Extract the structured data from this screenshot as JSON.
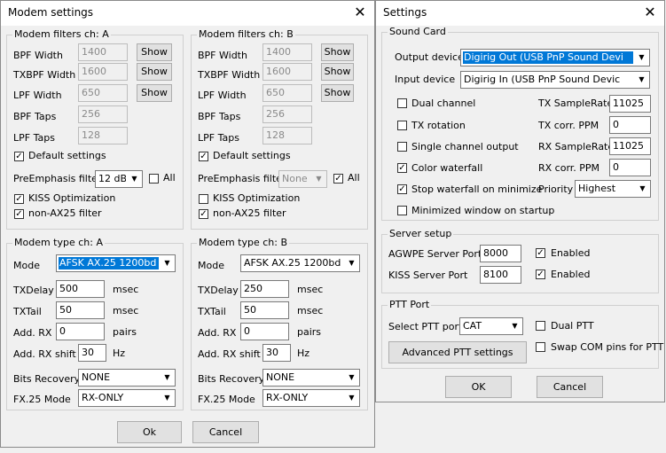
{
  "modem": {
    "title": "Modem settings",
    "filters": [
      {
        "legend": "Modem filters ch: A",
        "bpf_width_label": "BPF Width",
        "bpf_width": "1400",
        "txbpf_width_label": "TXBPF Width",
        "txbpf_width": "1600",
        "lpf_width_label": "LPF Width",
        "lpf_width": "650",
        "bpf_taps_label": "BPF Taps",
        "bpf_taps": "256",
        "lpf_taps_label": "LPF Taps",
        "lpf_taps": "128",
        "show_label": "Show",
        "default_label": "Default settings",
        "preemph_label": "PreEmphasis filter",
        "preemph_value": "12 dB",
        "all_label": "All",
        "kiss_label": "KISS Optimization",
        "nonax_label": "non-AX25 filter"
      },
      {
        "legend": "Modem filters ch: B",
        "bpf_width_label": "BPF Width",
        "bpf_width": "1400",
        "txbpf_width_label": "TXBPF Width",
        "txbpf_width": "1600",
        "lpf_width_label": "LPF Width",
        "lpf_width": "650",
        "bpf_taps_label": "BPF Taps",
        "bpf_taps": "256",
        "lpf_taps_label": "LPF Taps",
        "lpf_taps": "128",
        "show_label": "Show",
        "default_label": "Default settings",
        "preemph_label": "PreEmphasis filter",
        "preemph_value": "None",
        "all_label": "All",
        "kiss_label": "KISS Optimization",
        "nonax_label": "non-AX25 filter"
      }
    ],
    "types": [
      {
        "legend": "Modem type ch: A",
        "mode_label": "Mode",
        "mode_value": "AFSK AX.25 1200bd",
        "txdelay_label": "TXDelay",
        "txdelay": "500",
        "txtail_label": "TXTail",
        "txtail": "50",
        "addrx_label": "Add. RX",
        "addrx": "0",
        "addrxshift_label": "Add. RX shift",
        "addrxshift": "30",
        "msec": "msec",
        "pairs": "pairs",
        "hz": "Hz",
        "bits_label": "Bits Recovery",
        "bits_value": "NONE",
        "fx25_label": "FX.25 Mode",
        "fx25_value": "RX-ONLY"
      },
      {
        "legend": "Modem type ch: B",
        "mode_label": "Mode",
        "mode_value": "AFSK AX.25 1200bd",
        "txdelay_label": "TXDelay",
        "txdelay": "250",
        "txtail_label": "TXTail",
        "txtail": "50",
        "addrx_label": "Add. RX",
        "addrx": "0",
        "addrxshift_label": "Add. RX shift",
        "addrxshift": "30",
        "msec": "msec",
        "pairs": "pairs",
        "hz": "Hz",
        "bits_label": "Bits Recovery",
        "bits_value": "NONE",
        "fx25_label": "FX.25 Mode",
        "fx25_value": "RX-ONLY"
      }
    ],
    "ok_label": "Ok",
    "cancel_label": "Cancel"
  },
  "settings": {
    "title": "Settings",
    "sound": {
      "legend": "Sound Card",
      "output_label": "Output device",
      "output_value": "Digirig Out (USB PnP Sound Devi",
      "input_label": "Input device",
      "input_value": "Digirig In (USB PnP Sound Devic",
      "dual_label": "Dual channel",
      "txrot_label": "TX rotation",
      "single_label": "Single channel output",
      "color_label": "Color waterfall",
      "stop_label": "Stop waterfall on minimize",
      "minimized_label": "Minimized window on startup",
      "tx_sr_label": "TX SampleRate",
      "tx_sr": "11025",
      "tx_ppm_label": "TX corr. PPM",
      "tx_ppm": "0",
      "rx_sr_label": "RX SampleRate",
      "rx_sr": "11025",
      "rx_ppm_label": "RX corr. PPM",
      "rx_ppm": "0",
      "priority_label": "Priority",
      "priority_value": "Highest"
    },
    "server": {
      "legend": "Server setup",
      "agwpe_label": "AGWPE Server Port",
      "agwpe_port": "8000",
      "kiss_label": "KISS Server Port",
      "kiss_port": "8100",
      "enabled_label": "Enabled"
    },
    "ptt": {
      "legend": "PTT Port",
      "select_label": "Select PTT port",
      "select_value": "CAT",
      "dual_label": "Dual PTT",
      "swap_label": "Swap COM pins for PTT",
      "advanced_label": "Advanced PTT settings"
    },
    "ok_label": "OK",
    "cancel_label": "Cancel"
  }
}
